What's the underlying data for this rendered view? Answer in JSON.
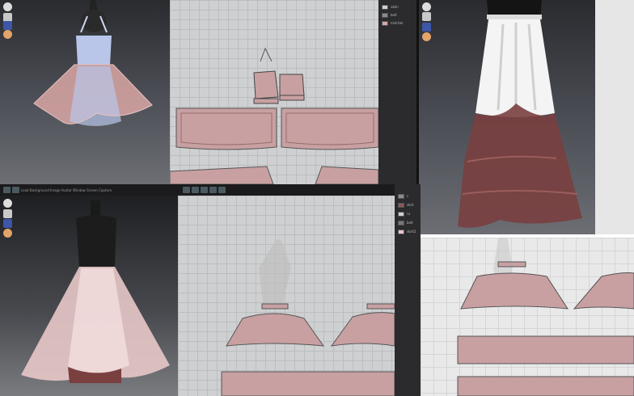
{
  "panels": {
    "top_left_3d": {
      "name": "3D viewport - dress"
    },
    "top_pattern": {
      "object_list": [
        {
          "label": "satin",
          "color": "#d0d0d0"
        },
        {
          "label": "belt",
          "color": "#8a8a8a"
        },
        {
          "label": "mid-tier",
          "color": "#d5a8aa"
        }
      ]
    },
    "top_right_3d": {
      "name": "3D viewport - long skirt"
    },
    "bottom_left_3d": {
      "toolbar_caption": "Load Background Image Avatar Window Screen Capture"
    },
    "bottom_pattern": {
      "object_list": [
        {
          "label": "c",
          "color": "#8c8c8c"
        },
        {
          "label": "skirt",
          "color": "#8b5a58"
        },
        {
          "label": "ru",
          "color": "#cfcfcf"
        },
        {
          "label": "belt",
          "color": "#777777"
        },
        {
          "label": "skirt2",
          "color": "#e8c8c8"
        }
      ]
    }
  },
  "colors": {
    "fabric_pink": "#d9a7a5",
    "fabric_lace": "#7a3f3f",
    "satin_white": "#f4f4f4",
    "top_blue": "#b9c6ea",
    "pattern_piece": "#c8a0a2"
  },
  "icons": [
    "avatar-icon",
    "user-icon",
    "sun-icon",
    "render-icon",
    "grid-icon",
    "sim-icon"
  ]
}
